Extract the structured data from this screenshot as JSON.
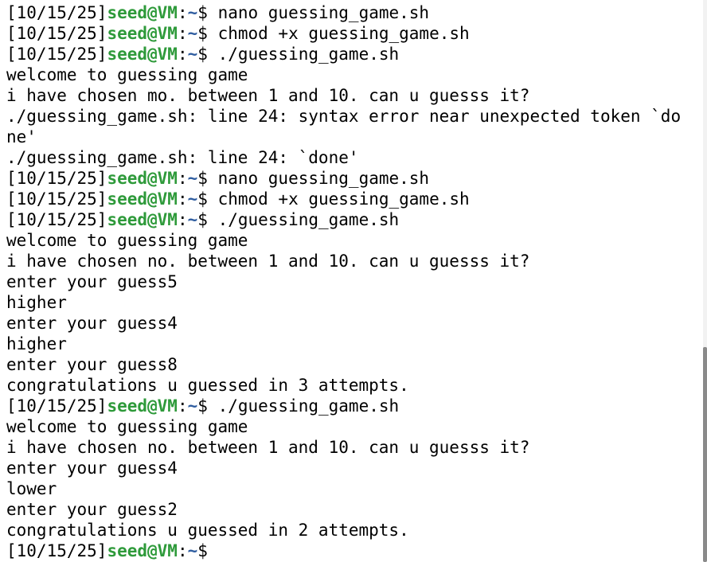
{
  "prompt": {
    "date": "[10/15/25]",
    "user": "seed@VM",
    "sep": ":",
    "path": "~",
    "symbol": "$ "
  },
  "lines": [
    {
      "type": "prompt",
      "cmd": "nano guessing_game.sh"
    },
    {
      "type": "prompt",
      "cmd": "chmod +x guessing_game.sh"
    },
    {
      "type": "prompt",
      "cmd": "./guessing_game.sh"
    },
    {
      "type": "out",
      "text": "welcome to guessing game"
    },
    {
      "type": "out",
      "text": "i have chosen mo. between 1 and 10. can u guesss it?"
    },
    {
      "type": "out",
      "text": "./guessing_game.sh: line 24: syntax error near unexpected token `do"
    },
    {
      "type": "out",
      "text": "ne'"
    },
    {
      "type": "out",
      "text": "./guessing_game.sh: line 24: `done'"
    },
    {
      "type": "prompt",
      "cmd": "nano guessing_game.sh"
    },
    {
      "type": "prompt",
      "cmd": "chmod +x guessing_game.sh"
    },
    {
      "type": "prompt",
      "cmd": "./guessing_game.sh"
    },
    {
      "type": "out",
      "text": "welcome to guessing game"
    },
    {
      "type": "out",
      "text": "i have chosen no. between 1 and 10. can u guesss it?"
    },
    {
      "type": "out",
      "text": "enter your guess5"
    },
    {
      "type": "out",
      "text": "higher"
    },
    {
      "type": "out",
      "text": "enter your guess4"
    },
    {
      "type": "out",
      "text": "higher"
    },
    {
      "type": "out",
      "text": "enter your guess8"
    },
    {
      "type": "out",
      "text": "congratulations u guessed in 3 attempts."
    },
    {
      "type": "prompt",
      "cmd": "./guessing_game.sh"
    },
    {
      "type": "out",
      "text": "welcome to guessing game"
    },
    {
      "type": "out",
      "text": "i have chosen no. between 1 and 10. can u guesss it?"
    },
    {
      "type": "out",
      "text": "enter your guess4"
    },
    {
      "type": "out",
      "text": "lower"
    },
    {
      "type": "out",
      "text": "enter your guess2"
    },
    {
      "type": "out",
      "text": "congratulations u guessed in 2 attempts."
    },
    {
      "type": "prompt",
      "cmd": ""
    }
  ],
  "colors": {
    "background": "#ffffff",
    "text": "#000000",
    "user": "#2e9a3a",
    "path": "#2f5da0",
    "scroll_thumb": "#8a8a8a"
  }
}
